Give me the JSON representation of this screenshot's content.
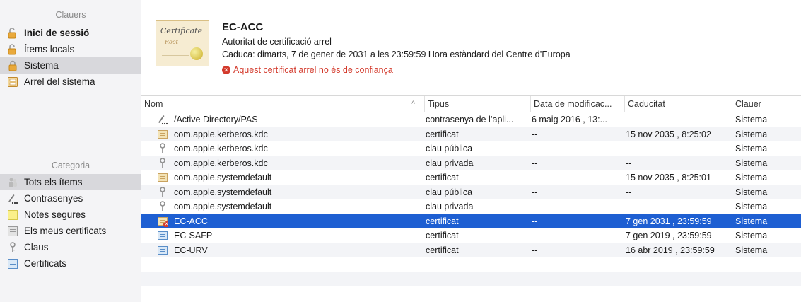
{
  "sidebar": {
    "keychains_title": "Clauers",
    "keychains": [
      {
        "label": "Inici de sessió",
        "icon": "lock-open-icon",
        "bold": true
      },
      {
        "label": "Ítems locals",
        "icon": "lock-open-icon",
        "bold": false
      },
      {
        "label": "Sistema",
        "icon": "lock-icon",
        "bold": false,
        "selected": true
      },
      {
        "label": "Arrel del sistema",
        "icon": "cabinet-icon",
        "bold": false
      }
    ],
    "category_title": "Categoria",
    "categories": [
      {
        "label": "Tots els ítems",
        "icon": "people-icon",
        "selected": true
      },
      {
        "label": "Contrasenyes",
        "icon": "pen-dots-icon"
      },
      {
        "label": "Notes segures",
        "icon": "note-icon"
      },
      {
        "label": "Els meus certificats",
        "icon": "my-certificate-icon"
      },
      {
        "label": "Claus",
        "icon": "key-icon"
      },
      {
        "label": "Certificats",
        "icon": "certificate-icon"
      }
    ]
  },
  "header": {
    "cert_image_title": "Certificate",
    "cert_image_sub": "Root",
    "name": "EC-ACC",
    "subtitle": "Autoritat de certificació arrel",
    "expires": "Caduca: dimarts, 7 de gener de 2031 a les 23:59:59 Hora estàndard del Centre d’Europa",
    "warning": "Aquest certificat arrel no és de confiança",
    "warning_color": "#d33a2c"
  },
  "table": {
    "columns": {
      "name": "Nom",
      "sort_indicator": "^",
      "type": "Tipus",
      "modified": "Data de modificac...",
      "expires": "Caducitat",
      "keychain": "Clauer"
    },
    "rows": [
      {
        "icon": "pen-dots-icon",
        "name": "/Active Directory/PAS",
        "type": "contrasenya de l’apli...",
        "modified": "6 maig 2016 , 13:...",
        "expires": "--",
        "keychain": "Sistema"
      },
      {
        "icon": "certificate-icon",
        "name": "com.apple.kerberos.kdc",
        "type": "certificat",
        "modified": "--",
        "expires": "15 nov 2035 , 8:25:02",
        "keychain": "Sistema"
      },
      {
        "icon": "key-icon",
        "name": "com.apple.kerberos.kdc",
        "type": "clau pública",
        "modified": "--",
        "expires": "--",
        "keychain": "Sistema"
      },
      {
        "icon": "key-icon",
        "name": "com.apple.kerberos.kdc",
        "type": "clau privada",
        "modified": "--",
        "expires": "--",
        "keychain": "Sistema"
      },
      {
        "icon": "certificate-icon",
        "name": "com.apple.systemdefault",
        "type": "certificat",
        "modified": "--",
        "expires": "15 nov 2035 , 8:25:01",
        "keychain": "Sistema"
      },
      {
        "icon": "key-icon",
        "name": "com.apple.systemdefault",
        "type": "clau pública",
        "modified": "--",
        "expires": "--",
        "keychain": "Sistema"
      },
      {
        "icon": "key-icon",
        "name": "com.apple.systemdefault",
        "type": "clau privada",
        "modified": "--",
        "expires": "--",
        "keychain": "Sistema"
      },
      {
        "icon": "untrusted-certificate-icon",
        "name": "EC-ACC",
        "type": "certificat",
        "modified": "--",
        "expires": "7 gen 2031 , 23:59:59",
        "keychain": "Sistema",
        "selected": true
      },
      {
        "icon": "blue-certificate-icon",
        "name": "EC-SAFP",
        "type": "certificat",
        "modified": "--",
        "expires": "7 gen 2019 , 23:59:59",
        "keychain": "Sistema"
      },
      {
        "icon": "blue-certificate-icon",
        "name": "EC-URV",
        "type": "certificat",
        "modified": "--",
        "expires": "16 abr 2019 , 23:59:59",
        "keychain": "Sistema"
      }
    ],
    "selection_color": "#1e5fd2"
  }
}
